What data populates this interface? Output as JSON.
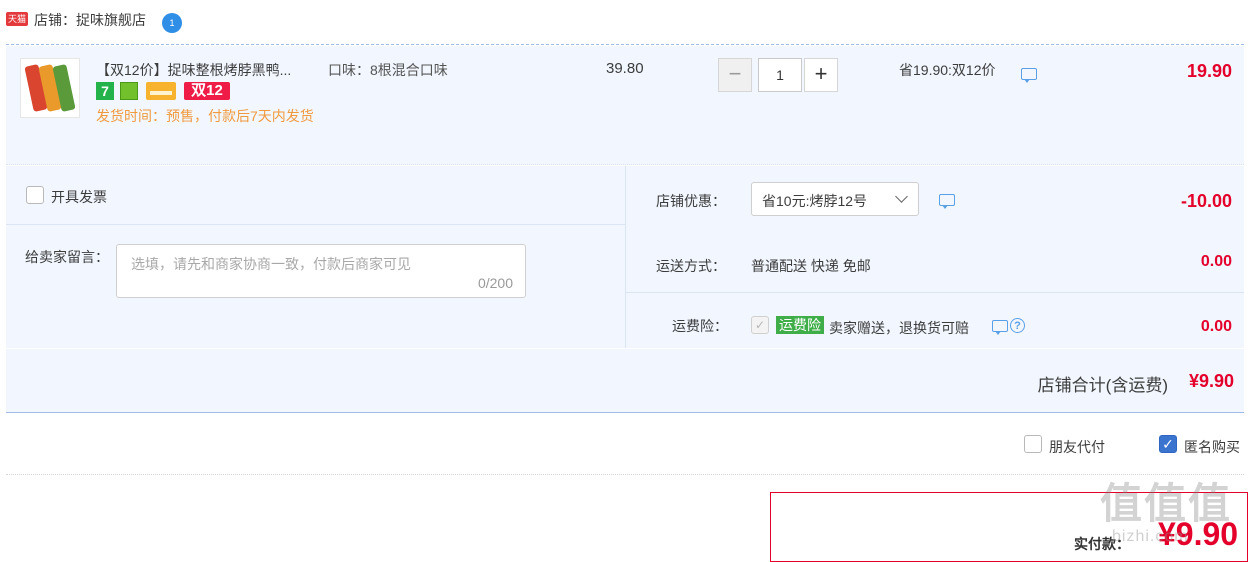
{
  "store": {
    "badge": "天猫",
    "label": "店铺：捉味旗舰店",
    "ww_badge": "1"
  },
  "item": {
    "title": "【双12价】捉味整根烤脖黑鸭...",
    "flavor": "口味：8根混合口味",
    "unit_price": "39.80",
    "badge_7": "7",
    "badge_d12": "双12",
    "ship_note": "发货时间：预售，付款后7天内发货",
    "quantity": "1",
    "minus": "−",
    "plus": "+",
    "promo": "省19.90:双12价",
    "total": "19.90"
  },
  "options": {
    "invoice_label": "开具发票",
    "message_label": "给卖家留言：",
    "message_placeholder": "选填，请先和商家协商一致，付款后商家可见",
    "message_count": "0/200",
    "coupon_label": "店铺优惠：",
    "coupon_value": "省10元:烤脖12号",
    "coupon_amount": "-10.00",
    "shipping_label": "运送方式：",
    "shipping_value": "普通配送 快递 免邮",
    "shipping_amount": "0.00",
    "insurance_label": "运费险：",
    "insurance_tag": "运费险",
    "insurance_text": "卖家赠送，退换货可赔",
    "insurance_amount": "0.00",
    "help": "?"
  },
  "store_total": {
    "label": "店铺合计(含运费)",
    "amount": "¥9.90"
  },
  "footer": {
    "friend_pay": "朋友代付",
    "anonymous": "匿名购买",
    "pay_label": "实付款：",
    "pay_amount": "¥9.90",
    "watermark": "值值值",
    "watermark_url": "bizhi.com"
  },
  "colors": {
    "accent_red": "#e4002b",
    "ship_orange": "#f09a3e",
    "panel_blue": "#f2f7ff"
  }
}
